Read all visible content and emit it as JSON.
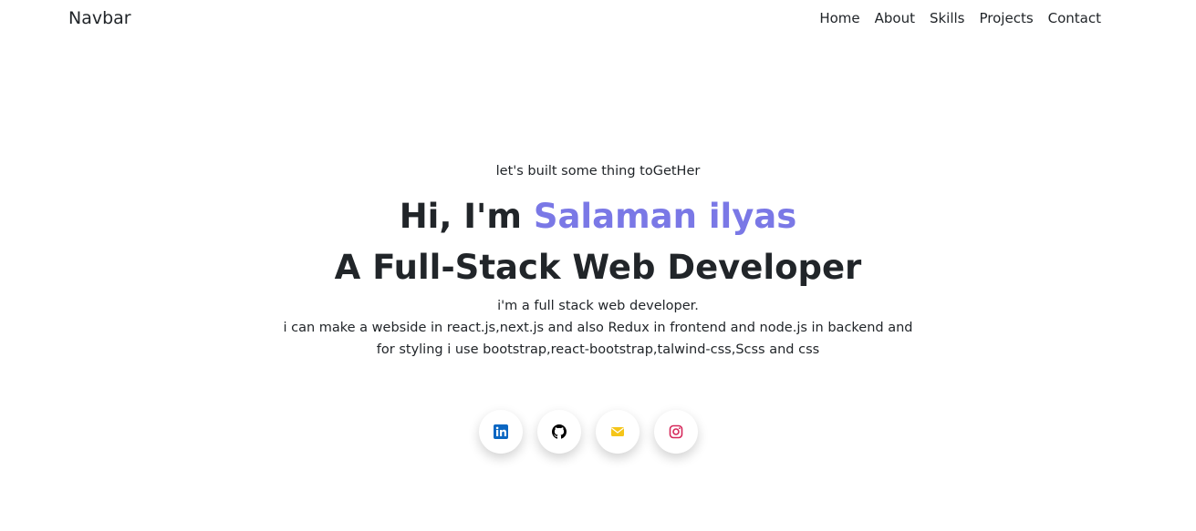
{
  "navbar": {
    "brand": "Navbar",
    "links": [
      "Home",
      "About",
      "Skills",
      "Projects",
      "Contact"
    ]
  },
  "hero": {
    "tagline": "let's built some thing toGetHer",
    "greeting_prefix": "Hi, I'm",
    "name": "Salaman ilyas",
    "role": "A Full-Stack Web Developer",
    "description": [
      "i'm a full stack web developer.",
      "i can make a webside in react.js,next.js and also Redux in frontend and node.js in backend and",
      "for styling i use bootstrap,react-bootstrap,talwind-css,Scss and css"
    ]
  },
  "socials": [
    {
      "icon": "linkedin-icon",
      "color": "#0a66c2"
    },
    {
      "icon": "github-icon",
      "color": "#000000"
    },
    {
      "icon": "mail-icon",
      "color": "#f5c518"
    },
    {
      "icon": "instagram-icon",
      "color": "#d6285a"
    }
  ],
  "colors": {
    "accent": "#7a78e6",
    "text": "#212529"
  }
}
